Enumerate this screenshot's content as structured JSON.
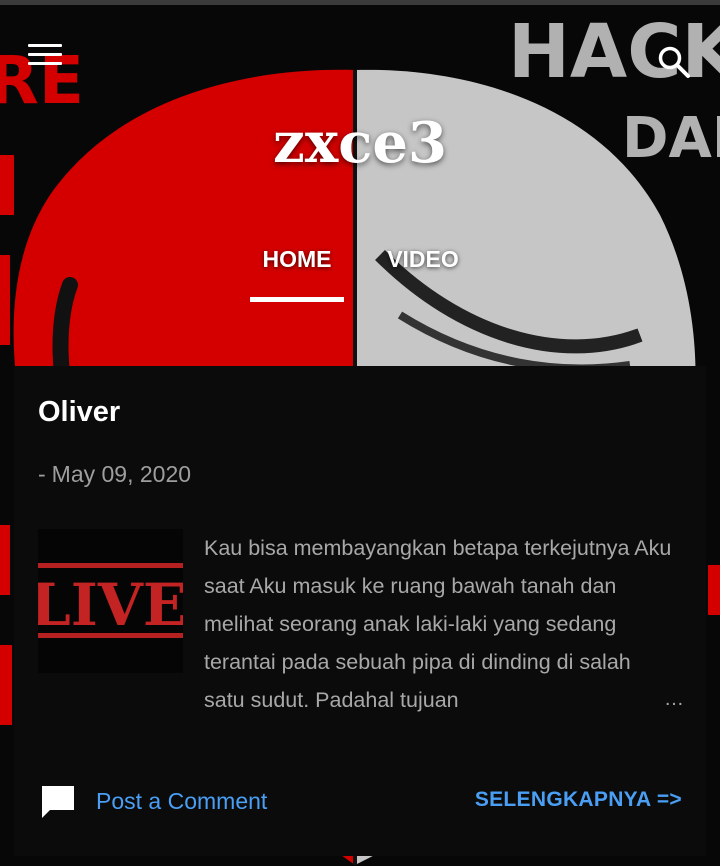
{
  "header": {
    "site_title": "zxce3",
    "menu_icon": "hamburger-menu-icon",
    "search_icon": "search-icon",
    "background_text": [
      "HACK",
      "DAR",
      "RE"
    ]
  },
  "nav": {
    "tabs": [
      {
        "label": "HOME",
        "active": true
      },
      {
        "label": "VIDEO",
        "active": false
      }
    ]
  },
  "post": {
    "title": "Oliver",
    "date_prefix": "-",
    "date": "May 09, 2020",
    "thumbnail_text": "LIVER",
    "snippet": "Kau bisa membayangkan betapa terkejutnya Aku saat Aku masuk ke ruang bawah tanah dan melihat seorang anak laki-laki yang sedang terantai pada sebuah pipa di dinding di salah satu sudut. Padahal tujuan",
    "ellipsis": "…",
    "comment_label": "Post a Comment",
    "read_more_label": "SELENGKAPNYA =>"
  },
  "colors": {
    "background": "#000000",
    "card": "#0b0b0b",
    "link": "#4a9ff5",
    "muted_text": "#a8a8a8",
    "mask_red": "#d40000",
    "mask_white": "#c9c9c9"
  }
}
